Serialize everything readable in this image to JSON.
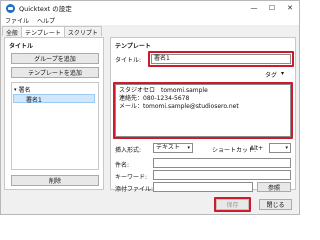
{
  "window": {
    "title": "Quicktext の設定"
  },
  "menu": [
    "ファイル",
    "ヘルプ"
  ],
  "tabs": [
    {
      "label": "全般",
      "active": false
    },
    {
      "label": "テンプレート",
      "active": true
    },
    {
      "label": "スクリプト",
      "active": false
    }
  ],
  "left": {
    "section_title": "タイトル",
    "add_group": "グループを追加",
    "add_template": "テンプレートを追加",
    "tree": {
      "group": "署名",
      "item": "署名1"
    },
    "delete": "削除"
  },
  "right": {
    "section_title": "テンプレート",
    "title_label": "タイトル:",
    "title_value": "署名1",
    "tag_label": "タグ",
    "body_lines": [
      "スタジオセロ　tomomi.sample",
      "連絡先：080-1234-5678",
      "メール：tomomi.sample@studiosero.net"
    ],
    "insert_format_label": "挿入形式:",
    "insert_format_value": "テキスト",
    "shortcut_label": "ショートカット:",
    "shortcut_value": "Alt+",
    "subject_label": "件名:",
    "keyword_label": "キーワード:",
    "attachment_label": "添付ファイル:",
    "browse": "参照"
  },
  "footer": {
    "save": "保存",
    "close": "閉じる"
  },
  "colors": {
    "highlight": "#cc1b2a",
    "selected": "#cfe6fb",
    "accent": "#1f6fc5"
  }
}
